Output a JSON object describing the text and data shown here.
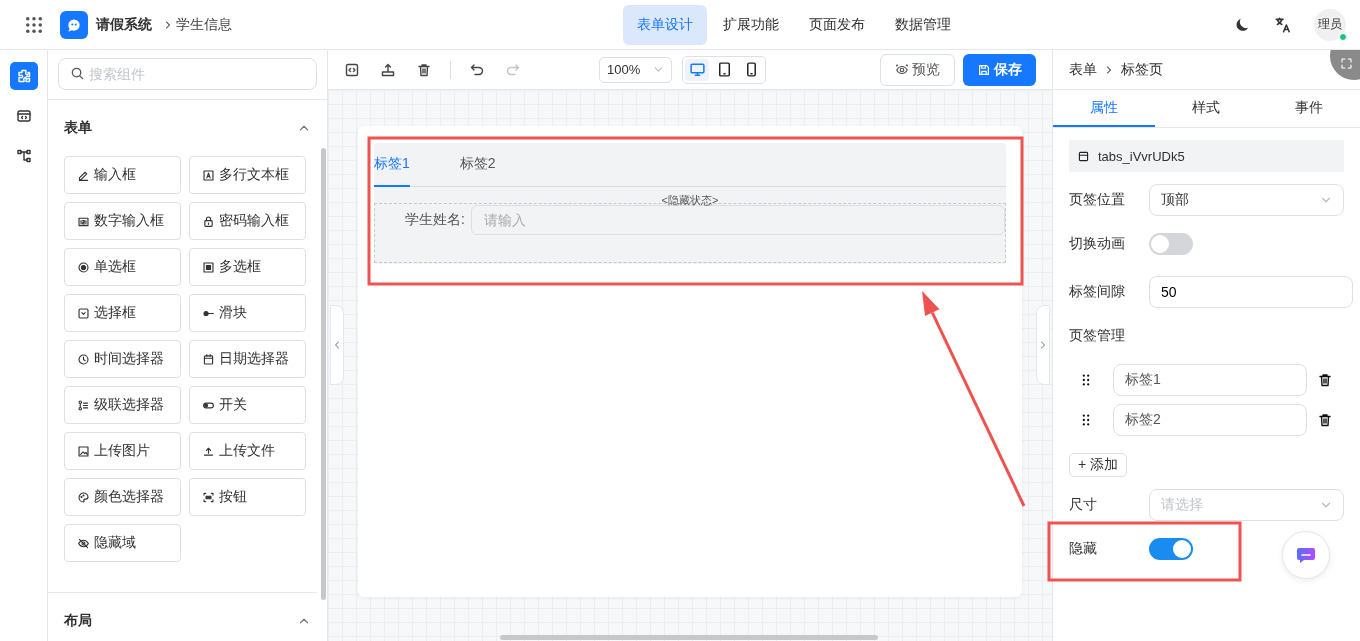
{
  "header": {
    "app_name": "请假系统",
    "breadcrumb": "学生信息",
    "avatar": "理员",
    "online": true
  },
  "nav": [
    {
      "label": "表单设计",
      "selected": true
    },
    {
      "label": "扩展功能",
      "selected": false
    },
    {
      "label": "页面发布",
      "selected": false
    },
    {
      "label": "数据管理",
      "selected": false
    }
  ],
  "rail": [
    {
      "selected": true
    },
    {
      "selected": false
    },
    {
      "selected": false
    }
  ],
  "left_panel": {
    "search": {
      "placeholder": "搜索组件"
    },
    "groups": [
      {
        "title": "表单",
        "expanded": true,
        "items": [
          "输入框",
          "多行文本框",
          "数字输入框",
          "密码输入框",
          "单选框",
          "多选框",
          "选择框",
          "滑块",
          "时间选择器",
          "日期选择器",
          "级联选择器",
          "开关",
          "上传图片",
          "上传文件",
          "颜色选择器",
          "按钮",
          "隐藏域"
        ]
      },
      {
        "title": "布局",
        "expanded": true
      }
    ]
  },
  "toolbar": {
    "redo_disabled": true,
    "zoom": "100%",
    "devices": [
      {
        "selected": true
      },
      {
        "selected": false
      },
      {
        "selected": false
      }
    ],
    "preview": "预览",
    "save": "保存"
  },
  "canvas": {
    "tabs": [
      {
        "label": "标签1",
        "selected": true
      },
      {
        "label": "标签2",
        "selected": false
      }
    ],
    "hidden_badge": "<隐藏状态>",
    "field": {
      "label": "学生姓名:",
      "placeholder": "请输入"
    }
  },
  "properties": {
    "breadcrumb": [
      "表单",
      "标签页"
    ],
    "tabs": [
      {
        "label": "属性",
        "selected": true
      },
      {
        "label": "样式",
        "selected": false
      },
      {
        "label": "事件",
        "selected": false
      }
    ],
    "component_id": "tabs_iVvrUDk5",
    "fields": [
      {
        "kind": "select",
        "label": "页签位置",
        "value": "顶部"
      },
      {
        "kind": "switch",
        "label": "切换动画",
        "on": false
      },
      {
        "kind": "input",
        "label": "标签间隙",
        "value": "50"
      },
      {
        "kind": "list",
        "label": "页签管理",
        "items": [
          "标签1",
          "标签2"
        ],
        "add": "+ 添加"
      },
      {
        "kind": "select",
        "label": "尺寸",
        "placeholder": "请选择"
      },
      {
        "kind": "switch",
        "label": "隐藏",
        "on": true
      }
    ]
  },
  "annotations": [
    {
      "kind": "box",
      "color": "#ef5350"
    },
    {
      "kind": "arrow",
      "color": "#ef5350"
    },
    {
      "kind": "box",
      "color": "#ef5350"
    }
  ]
}
